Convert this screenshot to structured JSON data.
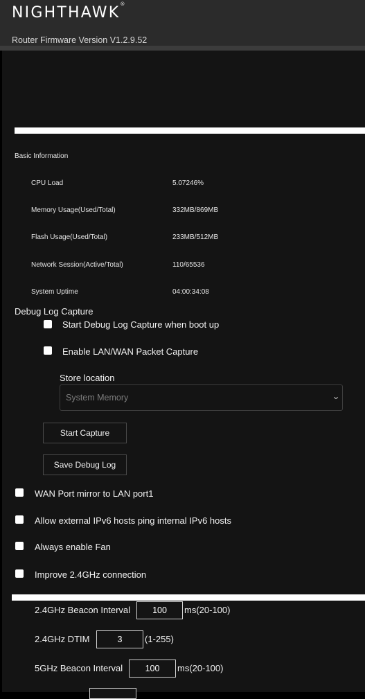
{
  "header": {
    "brand": "NIGHTHAWK",
    "trademark": "®",
    "firmware": "Router Firmware Version V1.2.9.52"
  },
  "basic_info": {
    "title": "Basic Information",
    "rows": [
      {
        "label": "CPU Load",
        "value": "5.07246%"
      },
      {
        "label": "Memory Usage(Used/Total)",
        "value": "332MB/869MB"
      },
      {
        "label": "Flash Usage(Used/Total)",
        "value": "233MB/512MB"
      },
      {
        "label": "Network Session(Active/Total)",
        "value": "110/65536"
      },
      {
        "label": "System Uptime",
        "value": "04:00:34:08"
      }
    ]
  },
  "debug": {
    "title": "Debug Log Capture",
    "opt_boot": "Start Debug Log Capture when boot up",
    "opt_packet": "Enable LAN/WAN Packet Capture",
    "store_label": "Store location",
    "store_value": "System Memory",
    "start_btn": "Start Capture",
    "save_btn": "Save Debug Log"
  },
  "options": [
    "WAN Port mirror to LAN port1",
    "Allow external IPv6 hosts ping internal IPv6 hosts",
    "Always enable Fan",
    "Improve 2.4GHz connection"
  ],
  "wifi": {
    "beacon24_label": "2.4GHz Beacon Interval",
    "beacon24_value": "100",
    "beacon24_unit": "ms(20-100)",
    "dtim24_label": "2.4GHz DTIM",
    "dtim24_value": "3",
    "dtim24_unit": "(1-255)",
    "beacon5_label": "5GHz Beacon Interval",
    "beacon5_value": "100",
    "beacon5_unit": "ms(20-100)"
  }
}
